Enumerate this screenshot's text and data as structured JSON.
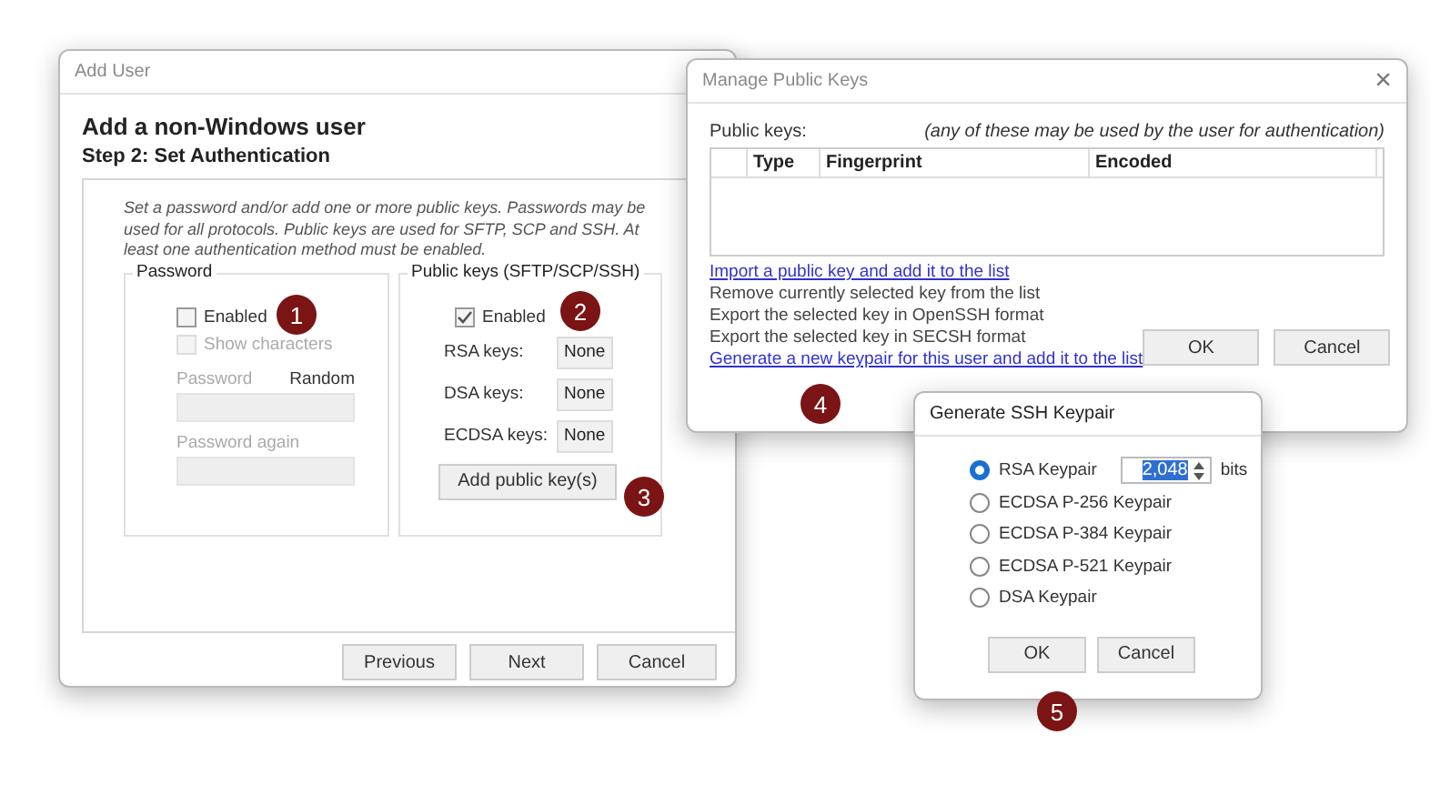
{
  "add_user": {
    "title": "Add User",
    "heading": "Add a non-Windows user",
    "step": "Step 2: Set Authentication",
    "description": "Set a password and/or add one or more public keys.  Passwords may be used for all protocols.  Public keys are used for SFTP, SCP and SSH.  At least one authentication method must be enabled.",
    "password_group": {
      "label": "Password",
      "enabled": {
        "label": "Enabled",
        "checked": false
      },
      "show_characters": {
        "label": "Show characters",
        "checked": false,
        "disabled": true
      },
      "password_label": "Password",
      "random_label": "Random",
      "password_again_label": "Password again"
    },
    "public_keys_group": {
      "label": "Public keys (SFTP/SCP/SSH)",
      "enabled": {
        "label": "Enabled",
        "checked": true
      },
      "key_rows": [
        {
          "label": "RSA keys:",
          "value": "None"
        },
        {
          "label": "DSA keys:",
          "value": "None"
        },
        {
          "label": "ECDSA keys:",
          "value": "None"
        }
      ],
      "add_button": "Add public key(s)"
    },
    "buttons": [
      "Previous",
      "Next",
      "Cancel"
    ]
  },
  "manage_keys": {
    "title": "Manage Public Keys",
    "close": "×",
    "list_label": "Public keys:",
    "hint": "(any of these may be used by the user for authentication)",
    "columns": [
      "Type",
      "Fingerprint",
      "Encoded"
    ],
    "actions": [
      {
        "label": "Import a public key and add it to the list",
        "kind": "link"
      },
      {
        "label": "Remove currently selected key from the list",
        "kind": "text"
      },
      {
        "label": "Export the selected key in OpenSSH format",
        "kind": "text"
      },
      {
        "label": "Export the selected key in SECSH format",
        "kind": "text"
      },
      {
        "label": "Generate a new keypair for this user and add it to the list",
        "kind": "link"
      }
    ],
    "buttons": [
      "OK",
      "Cancel"
    ]
  },
  "generate": {
    "title": "Generate SSH Keypair",
    "options": [
      {
        "label": "RSA Keypair",
        "selected": true
      },
      {
        "label": "ECDSA P-256 Keypair",
        "selected": false
      },
      {
        "label": "ECDSA P-384 Keypair",
        "selected": false
      },
      {
        "label": "ECDSA P-521 Keypair",
        "selected": false
      },
      {
        "label": "DSA Keypair",
        "selected": false
      }
    ],
    "bits_value": "2,048",
    "bits_unit": "bits",
    "buttons": [
      "OK",
      "Cancel"
    ]
  },
  "badges": [
    "1",
    "2",
    "3",
    "4",
    "5"
  ]
}
